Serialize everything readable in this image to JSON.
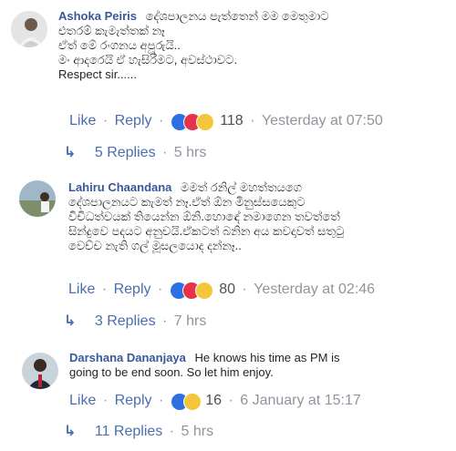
{
  "comments": [
    {
      "author": "Ashoka Peiris",
      "text_lines": [
        "දේශපාලනය පැත්තෙන් මම මෙතුමාට",
        "එතරම් කැමැත්තක් නෑ",
        "ඒත් මේ රංගනය අපූරුයි..",
        "මං ආදරෙයි ඒ හැසිරීමට, අවස්ථාවට.",
        "Respect sir......"
      ],
      "like_label": "Like",
      "reply_label": "Reply",
      "reaction_count": "118",
      "timestamp": "Yesterday at 07:50",
      "replies_label": "5 Replies",
      "replies_time": "5 hrs"
    },
    {
      "author": "Lahiru Chaandana",
      "text_lines": [
        "මමත් රනිල් මහත්තයගෙ",
        "දේශපාලනයට කැමත් නෑ.ඒත් ඕන මිනුස්සයෙකුට",
        "විචිධත්වයක් තියෙන්න ඕනි.හොඳේ නමාගෙන තවත්තේ",
        "සින්දුවෙ පදයට අනුවයි.ඒකටත් බනින අය කවදාවත් සතුටු",
        "වෙච්ච නැති ගල් මූසලයොද දන්නෑ.."
      ],
      "like_label": "Like",
      "reply_label": "Reply",
      "reaction_count": "80",
      "timestamp": "Yesterday at 02:46",
      "replies_label": "3 Replies",
      "replies_time": "7 hrs"
    },
    {
      "author": "Darshana Dananjaya",
      "text_lines": [
        "He knows his time as PM is",
        "going to be end soon. So let him enjoy."
      ],
      "like_label": "Like",
      "reply_label": "Reply",
      "reaction_count": "16",
      "timestamp": "6 January at 15:17",
      "replies_label": "11 Replies",
      "replies_time": "5 hrs"
    }
  ],
  "separator": "·",
  "reply_arrow": "↳"
}
